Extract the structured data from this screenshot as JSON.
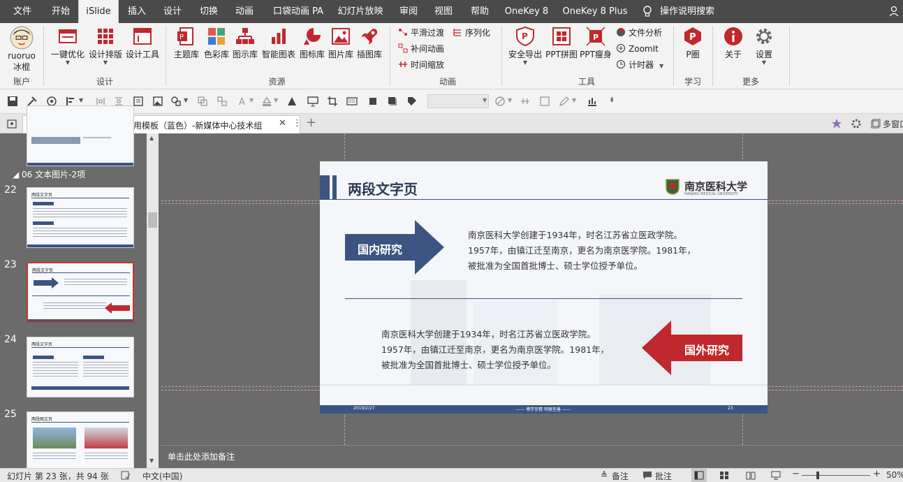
{
  "menu": {
    "tabs": [
      "文件",
      "开始",
      "iSlide",
      "插入",
      "设计",
      "切换",
      "动画",
      "口袋动画 PA",
      "幻灯片放映",
      "审阅",
      "视图",
      "帮助",
      "OneKey 8",
      "OneKey 8 Plus"
    ],
    "active_tab": "iSlide",
    "search_label": "操作说明搜索"
  },
  "ribbon": {
    "account": {
      "line1": "ruoruo",
      "line2": "冰棍",
      "group": "账户"
    },
    "design": {
      "items": [
        "一键优化",
        "设计排版",
        "设计工具"
      ],
      "group": "设计"
    },
    "resources": {
      "items": [
        "主题库",
        "色彩库",
        "图示库",
        "智能图表",
        "图标库",
        "图片库",
        "插图库"
      ],
      "group": "资源"
    },
    "animation": {
      "items": [
        "平滑过渡",
        "序列化",
        "补间动画",
        "时间缩放"
      ],
      "group": "动画"
    },
    "tools": {
      "items": [
        "安全导出",
        "PPT拼图",
        "PPT瘦身"
      ],
      "small": [
        "文件分析",
        "ZoomIt",
        "计时器"
      ],
      "group": "工具"
    },
    "learn": {
      "item": "P圈",
      "group": "学习"
    },
    "more": {
      "items": [
        "关于",
        "设置"
      ],
      "group": "更多"
    }
  },
  "document": {
    "tab_title": "南京医科大学汇报答辩通用模板（蓝色）-新媒体中心技术组"
  },
  "slides_panel": {
    "section": "06 文本图片-2项",
    "slide_numbers": [
      "22",
      "23",
      "24",
      "25"
    ],
    "thumb_titles": [
      "两段文字页",
      "两段文字页",
      "两段文字页",
      "两段图文页"
    ]
  },
  "slide": {
    "title": "两段文字页",
    "university": "南京医科大学",
    "university_en": "NANJING MEDICAL UNIVERSITY",
    "domestic_label": "国内研究",
    "foreign_label": "国外研究",
    "para1": [
      "南京医科大学创建于1934年，时名江苏省立医政学院。",
      "1957年，由镇江迁至南京，更名为南京医学院。1981年，",
      "被批准为全国首批博士、硕士学位授予单位。"
    ],
    "para2": [
      "南京医科大学创建于1934年，时名江苏省立医政学院。",
      "1957年，由镇江迁至南京，更名为南京医学院。1981年，",
      "被批准为全国首批博士、硕士学位授予单位。"
    ],
    "footer_date": "2019/2/27",
    "footer_motto": "—— 博学至精  明德至善 ——",
    "footer_page": "23"
  },
  "notes_placeholder": "单击此处添加备注",
  "status": {
    "slide_info": "幻灯片 第 23 张，共 94 张",
    "language": "中文(中国)",
    "notes_btn": "备注",
    "comments_btn": "批注",
    "zoom": "50%",
    "multi_window": "多窗口"
  },
  "colors": {
    "navy": "#3b5482",
    "red": "#c0282d",
    "menubar": "#4a4a4a",
    "ribbon": "#f3f3f3"
  }
}
